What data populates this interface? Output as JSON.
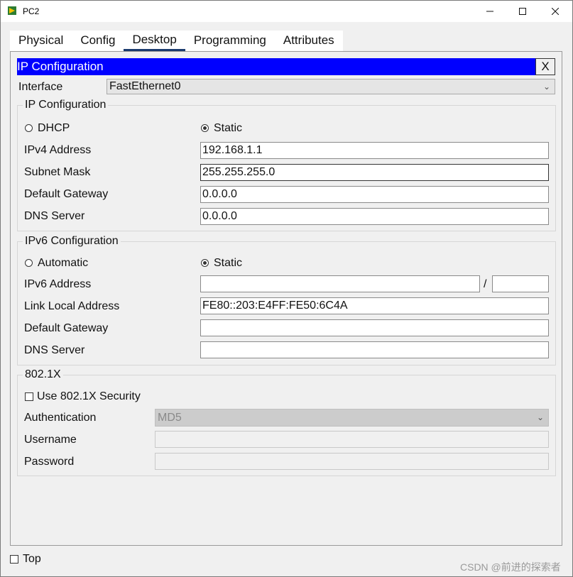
{
  "window": {
    "title": "PC2"
  },
  "tabs": [
    "Physical",
    "Config",
    "Desktop",
    "Programming",
    "Attributes"
  ],
  "active_tab": "Desktop",
  "dialog": {
    "title": "IP Configuration",
    "close_label": "X"
  },
  "interface": {
    "label": "Interface",
    "value": "FastEthernet0"
  },
  "ipv4": {
    "group_title": "IP Configuration",
    "dhcp_label": "DHCP",
    "static_label": "Static",
    "mode": "Static",
    "address_label": "IPv4 Address",
    "address": "192.168.1.1",
    "mask_label": "Subnet Mask",
    "mask": "255.255.255.0",
    "gateway_label": "Default Gateway",
    "gateway": "0.0.0.0",
    "dns_label": "DNS Server",
    "dns": "0.0.0.0"
  },
  "ipv6": {
    "group_title": "IPv6 Configuration",
    "auto_label": "Automatic",
    "static_label": "Static",
    "mode": "Static",
    "address_label": "IPv6 Address",
    "address": "",
    "prefix_sep": "/",
    "prefix": "",
    "link_local_label": "Link Local Address",
    "link_local": "FE80::203:E4FF:FE50:6C4A",
    "gateway_label": "Default Gateway",
    "gateway": "",
    "dns_label": "DNS Server",
    "dns": ""
  },
  "dot1x": {
    "group_title": "802.1X",
    "use_label": "Use 802.1X Security",
    "use_checked": false,
    "auth_label": "Authentication",
    "auth_value": "MD5",
    "username_label": "Username",
    "username": "",
    "password_label": "Password",
    "password": ""
  },
  "footer": {
    "top_label": "Top",
    "top_checked": false
  },
  "watermark": "CSDN @前进的探索者",
  "colors": {
    "title_bar": "#0000ff",
    "active_tab_underline": "#1a3a6e"
  }
}
